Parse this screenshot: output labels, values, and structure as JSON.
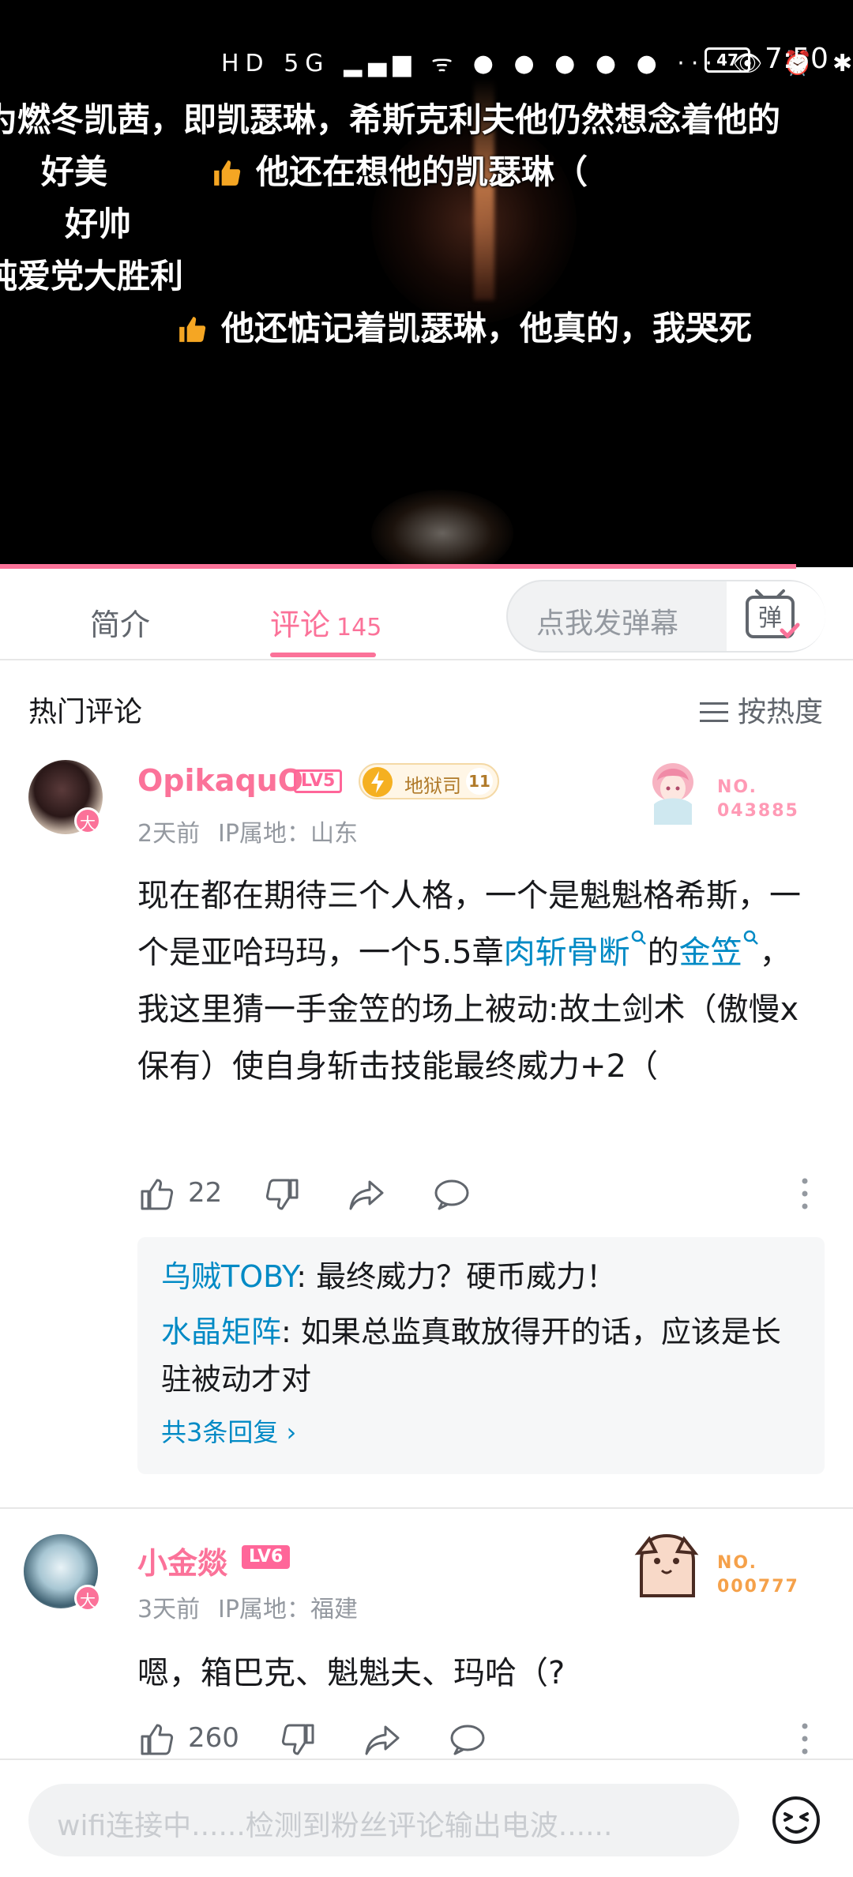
{
  "status_bar": {
    "icons": "HD 5G ▂▄▆ ᯤ ● ● ● ● ● ··· 👁 ⏰ ✱ 🔕",
    "battery": "47",
    "time": "7:50"
  },
  "danmaku": [
    "为燃冬凯茜，即凯瑟琳，希斯克利夫他仍然想念着他的",
    "好美",
    "他还在想他的凯瑟琳（",
    "好帅",
    "纯爱党大胜利",
    "他还惦记着凯瑟琳，他真的，我哭死"
  ],
  "tabs": {
    "intro": "简介",
    "comments": "评论",
    "comments_count": "145"
  },
  "danmaku_input": {
    "placeholder": "点我发弹幕",
    "button_glyph": "弹"
  },
  "comments_header": {
    "title": "热门评论",
    "sort_label": "按热度"
  },
  "comments": [
    {
      "username": "OpikaquO",
      "level": "LV5",
      "medal_name": "地狱司",
      "medal_level": "11",
      "avatar_badge": "大",
      "time": "2天前",
      "ip": "IP属地：山东",
      "no_label": "NO.",
      "no_value": "043885",
      "text_parts": {
        "p1": "现在都在期待三个人格，一个是魁魁格希斯，一个是亚哈玛玛，一个5.5章",
        "link1": "肉斩骨断",
        "p2": "的",
        "link2": "金笠",
        "p3": "，我这里猜一手金笠的场上被动:故土剑术（傲慢x保有）使自身斩击技能最终威力+2（"
      },
      "likes": "22",
      "replies": [
        {
          "name": "乌贼TOBY",
          "text": ": 最终威力？硬币威力！"
        },
        {
          "name": "水晶矩阵",
          "text": ": 如果总监真敢放得开的话，应该是长驻被动才对"
        }
      ],
      "reply_more": "共3条回复"
    },
    {
      "username": "小金燚",
      "level": "LV6",
      "avatar_badge": "大",
      "time": "3天前",
      "ip": "IP属地：福建",
      "no_label": "NO.",
      "no_value": "000777",
      "text": "嗯，箱巴克、魁魁夫、玛哈（?",
      "likes": "260"
    }
  ],
  "bottom_input": {
    "placeholder": "wifi连接中......检测到粉丝评论输出电波......"
  },
  "colors": {
    "accent": "#fb7299",
    "link": "#008ac5"
  }
}
